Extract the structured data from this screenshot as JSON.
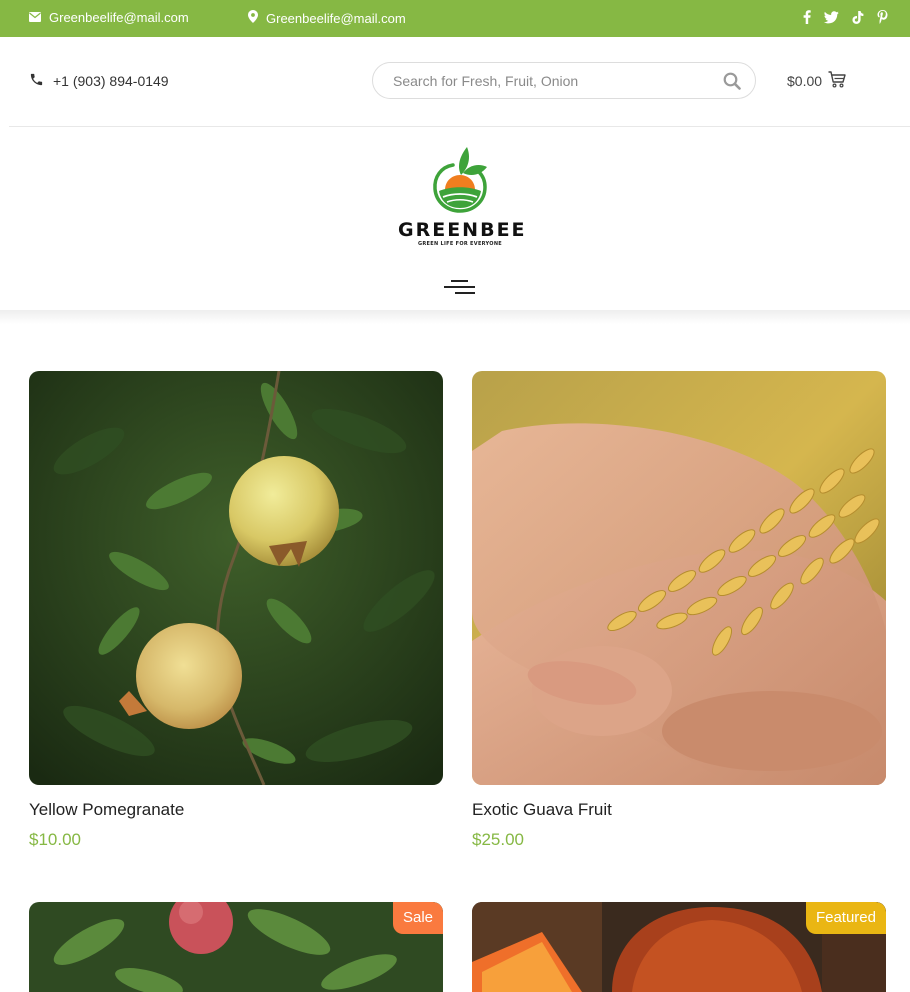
{
  "topbar": {
    "email": "Greenbeelife@mail.com",
    "location": "Greenbeelife@mail.com",
    "social_icons": [
      "facebook-icon",
      "twitter-icon",
      "tiktok-icon",
      "pinterest-icon"
    ]
  },
  "header": {
    "phone": "+1 (903) 894-0149",
    "search_placeholder": "Search for Fresh, Fruit, Onion",
    "cart_total": "$0.00"
  },
  "logo": {
    "brand": "GREENBEE",
    "tagline": "GREEN LIFE FOR EVERYONE"
  },
  "colors": {
    "accent": "#86b844",
    "sale_badge": "#fa7a3f",
    "featured_badge": "#eab613"
  },
  "products": [
    {
      "name": "Yellow Pomegranate",
      "price": "$10.00",
      "badge": ""
    },
    {
      "name": "Exotic Guava Fruit",
      "price": "$25.00",
      "badge": ""
    },
    {
      "name": "",
      "price": "",
      "badge": "Sale"
    },
    {
      "name": "",
      "price": "",
      "badge": "Featured"
    }
  ]
}
